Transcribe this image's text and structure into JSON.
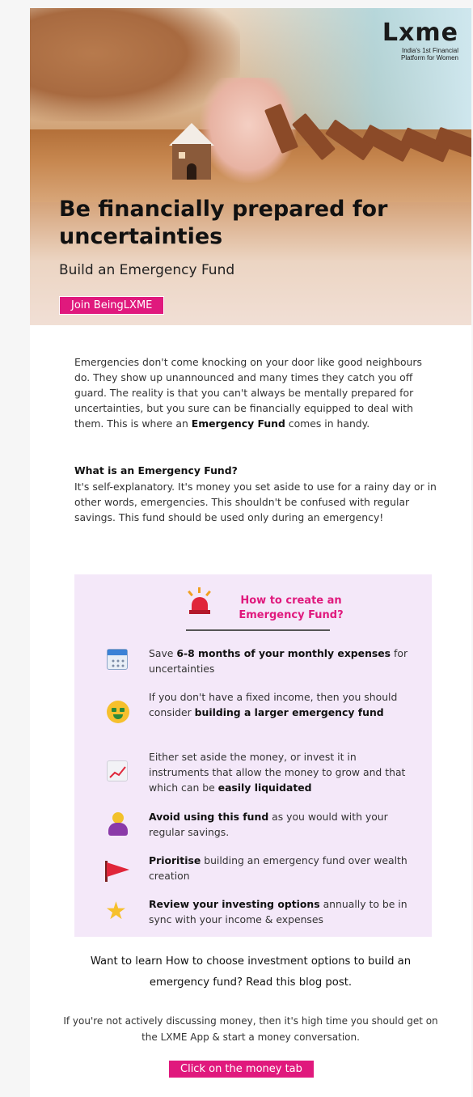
{
  "hero": {
    "logo": "Lxme",
    "logo_tagline_1": "India's 1st Financial",
    "logo_tagline_2": "Platform for Women",
    "title": "Be financially prepared for uncertainties",
    "subtitle": "Build an Emergency Fund",
    "cta_label": "Join BeingLXME"
  },
  "intro": {
    "text_before": "Emergencies don't come knocking on your door like good neighbours do. They show up unannounced and many times they catch you off guard. The reality is that you can't always be mentally prepared for uncertainties, but you sure can be financially equipped to deal with them. This is where an ",
    "bold": "Emergency Fund",
    "text_after": " comes in handy."
  },
  "what": {
    "heading": "What is an Emergency Fund?",
    "body": "It's self-explanatory. It's money you set aside to use for a rainy day or in other words, emergencies. This shouldn't be confused with regular savings. This fund should be used only during an emergency!"
  },
  "howto": {
    "title": "How to create an Emergency Fund?",
    "items": [
      {
        "icon": "calendar-icon",
        "pre": "Save ",
        "bold": "6-8 months of your monthly expenses",
        "post": " for uncertainties"
      },
      {
        "icon": "money-mouth-face-icon",
        "pre": "If you don't have a fixed income, then you should consider ",
        "bold": "building a larger emergency fund",
        "post": ""
      },
      {
        "icon": "chart-increasing-icon",
        "pre": "Either set aside the money, or invest it in instruments that allow the money to grow and that which can be ",
        "bold": "easily liquidated",
        "post": ""
      },
      {
        "icon": "person-gesturing-no-icon",
        "pre": "",
        "bold": "Avoid using this fund",
        "post": " as you would with your regular savings."
      },
      {
        "icon": "red-flag-icon",
        "pre": "",
        "bold": "Prioritise",
        "post": " building an emergency fund over wealth creation"
      },
      {
        "icon": "star-icon",
        "pre": "",
        "bold": "Review your investing options",
        "post": " annually to be in sync with your income & expenses"
      }
    ]
  },
  "blog_cta": "Want to learn How to choose investment options to build an emergency fund? Read this blog post.",
  "app_cta": "If you're not actively discussing money, then it's high time you should get on the LXME App & start a money conversation.",
  "money_tab_button": "Click on the money tab",
  "colors": {
    "accent": "#e0197d",
    "box_bg": "#f4e8f9"
  }
}
